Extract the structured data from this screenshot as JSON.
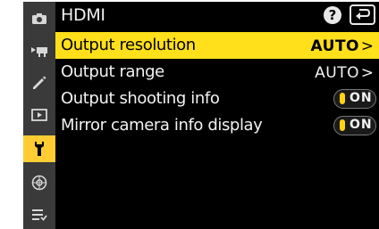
{
  "header": {
    "title": "HDMI",
    "help_label": "?"
  },
  "menu": {
    "rows": [
      {
        "label": "Output resolution",
        "value": "AUTO",
        "chevron": ">"
      },
      {
        "label": "Output range",
        "value": "AUTO",
        "chevron": ">"
      },
      {
        "label": "Output shooting info",
        "value": "ON"
      },
      {
        "label": "Mirror camera info display",
        "value": "ON"
      }
    ],
    "selected_index": 0
  },
  "sidebar": {
    "items": [
      {
        "icon": "photo-shooting-icon",
        "active": false
      },
      {
        "icon": "movie-shooting-icon",
        "active": false
      },
      {
        "icon": "custom-settings-pencil-icon",
        "active": false
      },
      {
        "icon": "playback-icon",
        "active": false
      },
      {
        "icon": "setup-wrench-icon",
        "active": true
      },
      {
        "icon": "network-icon",
        "active": false
      },
      {
        "icon": "my-menu-icon",
        "active": false
      }
    ]
  },
  "colors": {
    "highlight": "#ffe01a",
    "active_tab": "#ffcc33",
    "toggle_on": "#ffd21a",
    "sidebar_bg": "#3a3a3a",
    "screen_bg": "#000000"
  }
}
